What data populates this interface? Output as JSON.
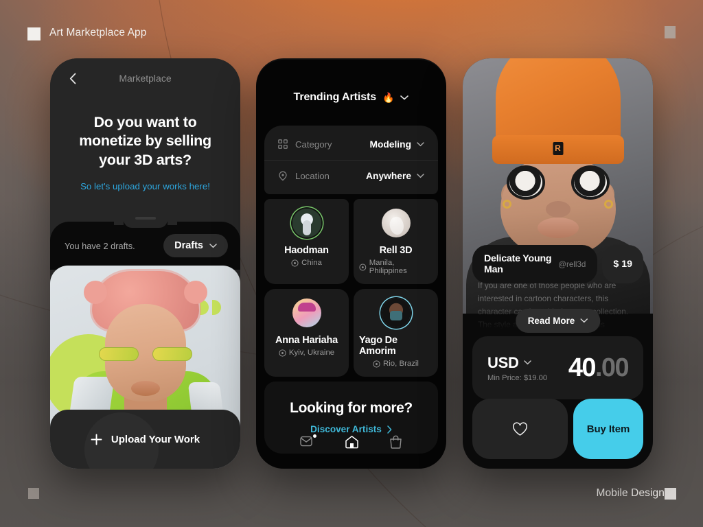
{
  "page": {
    "app_title": "Art Marketplace App",
    "footer_label": "Mobile Design"
  },
  "phone1": {
    "nav_back_icon": "chevron-left-icon",
    "nav_title": "Marketplace",
    "headline": "Do you want to monetize by selling your 3D arts?",
    "subline": "So let's upload your works here!",
    "drafts_text": "You have 2 drafts.",
    "drafts_button": "Drafts",
    "drafts_chevron_icon": "chevron-down-icon",
    "upload_button": "Upload Your Work",
    "upload_plus_icon": "plus-icon"
  },
  "phone2": {
    "header_title": "Trending Artists",
    "header_fire_icon": "🔥",
    "header_chevron_icon": "chevron-down-icon",
    "filters": [
      {
        "icon": "grid-icon",
        "label": "Category",
        "value": "Modeling",
        "chevron": "chevron-down-icon"
      },
      {
        "icon": "location-pin-icon",
        "label": "Location",
        "value": "Anywhere",
        "chevron": "chevron-down-icon"
      }
    ],
    "artists": [
      {
        "name": "Haodman",
        "location": "China"
      },
      {
        "name": "Rell 3D",
        "location": "Manila, Philippines"
      },
      {
        "name": "Anna Hariaha",
        "location": "Kyiv, Ukraine"
      },
      {
        "name": "Yago De Amorim",
        "location": "Rio, Brazil"
      }
    ],
    "more_title": "Looking for more?",
    "more_link": "Discover Artists",
    "more_link_chevron": "chevron-right-icon",
    "tabs": [
      {
        "icon": "mail-icon",
        "active": false,
        "badge": true
      },
      {
        "icon": "home-icon",
        "active": true,
        "badge": false
      },
      {
        "icon": "shopping-bag-icon",
        "active": false,
        "badge": false
      }
    ]
  },
  "phone3": {
    "item_title": "Delicate Young Man",
    "item_handle": "@rell3d",
    "item_price_badge": "$ 19",
    "description": "If you are one of those people who are interested in cartoon characters, this character can be added to your collection. The style and materials used in this character are Main deal",
    "read_more": "Read More",
    "read_more_chevron": "chevron-down-icon",
    "currency": "USD",
    "currency_chevron": "chevron-down-icon",
    "min_price": "Min Price: $19.00",
    "amount_whole": "40",
    "amount_decimal": ".00",
    "favorite_icon": "heart-icon",
    "buy_button": "Buy Item"
  },
  "colors": {
    "accent_cyan": "#45cdea",
    "link_blue": "#2ea8e0",
    "link_teal": "#3fb8d8",
    "background_orange": "#e8863a"
  }
}
